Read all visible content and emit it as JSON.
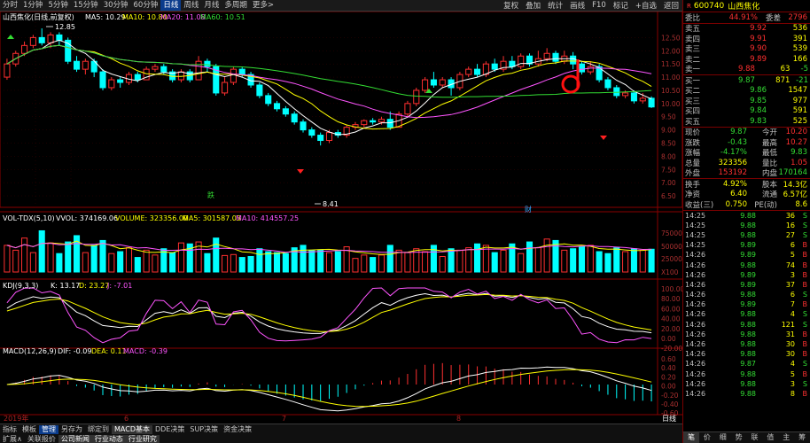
{
  "toolbar": {
    "tabs": [
      "分时",
      "1分钟",
      "5分钟",
      "15分钟",
      "30分钟",
      "60分钟",
      "日线",
      "周线",
      "月线",
      "多周期",
      "更多>"
    ],
    "active": "日线",
    "tools": [
      "复权",
      "叠加",
      "统计",
      "画线",
      "F10",
      "标记",
      "+自选",
      "返回"
    ]
  },
  "main_chart": {
    "title": "山西焦化(日线,前复权)",
    "ind": {
      "ma5": "MA5: 10.29",
      "ma10": "MA10: 10.80",
      "ma20": "MA20: 11.08",
      "ma60": "MA60: 10.51"
    },
    "high_label": "12.85",
    "low_label": "8.41",
    "ticks": [
      "12.50",
      "12.00",
      "11.50",
      "11.00",
      "10.50",
      "10.00",
      "9.50",
      "9.00",
      "8.50",
      "8.00",
      "7.50",
      "7.00",
      "6.50"
    ],
    "marker_die": "跌",
    "marker_cai": "财",
    "annotation": "d"
  },
  "vol_chart": {
    "title": "VOL-TDX(5,10)",
    "vvol": "VVOL: 374169.06",
    "volume": "VOLUME: 323356.00",
    "ma5": "MA5: 301587.03",
    "ma10": "MA10: 414557.25",
    "ticks": [
      "75000",
      "50000",
      "25000",
      "X100"
    ]
  },
  "kdj_chart": {
    "title": "KDJ(9,3,3)",
    "k": "K: 13.17",
    "d": "D: 23.27",
    "j": "J: -7.01",
    "ticks": [
      "100.00",
      "80.00",
      "60.00",
      "40.00",
      "20.00",
      "0.00",
      "-20.00"
    ]
  },
  "macd_chart": {
    "title": "MACD(12,26,9)",
    "dif": "DIF: -0.09",
    "dea": "DEA: 0.11",
    "macd": "MACD: -0.39",
    "ticks": [
      "0.60",
      "0.40",
      "0.20",
      "0.00",
      "-0.20",
      "-0.40",
      "-0.60"
    ]
  },
  "date_axis": {
    "year": "2019年",
    "labels": [
      "6",
      "7",
      "8"
    ],
    "period": "日线"
  },
  "bottom_tabs": {
    "row1": [
      "指标",
      "模板",
      "管理",
      "另存为",
      "绑定到",
      "MACD基本",
      "DDE决策",
      "SUP决策",
      "资金决策"
    ],
    "row1_sel": "管理",
    "row2": [
      "扩展∧",
      "关联报价",
      "公司新闻",
      "行业动态",
      "行业研究"
    ]
  },
  "quote": {
    "code": "600740",
    "name": "山西焦化",
    "badge": "R",
    "weibi": {
      "label": "委比",
      "value": "44.91%",
      "label2": "委差",
      "value2": "2796"
    },
    "sell": [
      {
        "label": "卖五",
        "price": "9.92",
        "vol": "536"
      },
      {
        "label": "卖四",
        "price": "9.91",
        "vol": "391"
      },
      {
        "label": "卖三",
        "price": "9.90",
        "vol": "539"
      },
      {
        "label": "卖二",
        "price": "9.89",
        "vol": "166"
      },
      {
        "label": "卖一",
        "price": "9.88",
        "vol": "63",
        "chg": "-5"
      }
    ],
    "buy": [
      {
        "label": "买一",
        "price": "9.87",
        "vol": "871",
        "chg": "-21"
      },
      {
        "label": "买二",
        "price": "9.86",
        "vol": "1547",
        "chg": ""
      },
      {
        "label": "买三",
        "price": "9.85",
        "vol": "977",
        "chg": ""
      },
      {
        "label": "买四",
        "price": "9.84",
        "vol": "591",
        "chg": ""
      },
      {
        "label": "买五",
        "price": "9.83",
        "vol": "525",
        "chg": ""
      }
    ],
    "stats": [
      {
        "l1": "现价",
        "v1": "9.87",
        "l2": "今开",
        "v2": "10.20"
      },
      {
        "l1": "涨跌",
        "v1": "-0.43",
        "l2": "最高",
        "v2": "10.27"
      },
      {
        "l1": "涨幅",
        "v1": "-4.17%",
        "l2": "最低",
        "v2": "9.83"
      },
      {
        "l1": "总量",
        "v1": "323356",
        "l2": "量比",
        "v2": "1.05"
      },
      {
        "l1": "外盘",
        "v1": "153192",
        "l2": "内盘",
        "v2": "170164"
      }
    ],
    "stats2": [
      {
        "l1": "换手",
        "v1": "4.92%",
        "l2": "股本",
        "v2": "14.3亿"
      },
      {
        "l1": "净资",
        "v1": "6.40",
        "l2": "流通",
        "v2": "6.57亿"
      },
      {
        "l1": "收益(三)",
        "v1": "0.750",
        "l2": "PE(动)",
        "v2": "8.6"
      }
    ],
    "ticks": [
      {
        "time": "14:25",
        "price": "9.88",
        "vol": "36",
        "dir": "S"
      },
      {
        "time": "14:25",
        "price": "9.88",
        "vol": "16",
        "dir": "S"
      },
      {
        "time": "14:25",
        "price": "9.88",
        "vol": "27",
        "dir": "S"
      },
      {
        "time": "14:25",
        "price": "9.89",
        "vol": "6",
        "dir": "B"
      },
      {
        "time": "14:26",
        "price": "9.89",
        "vol": "5",
        "dir": "B"
      },
      {
        "time": "14:26",
        "price": "9.88",
        "vol": "74",
        "dir": "B"
      },
      {
        "time": "14:26",
        "price": "9.89",
        "vol": "3",
        "dir": "B"
      },
      {
        "time": "14:26",
        "price": "9.89",
        "vol": "37",
        "dir": "B"
      },
      {
        "time": "14:26",
        "price": "9.88",
        "vol": "6",
        "dir": "S"
      },
      {
        "time": "14:26",
        "price": "9.89",
        "vol": "7",
        "dir": "B"
      },
      {
        "time": "14:26",
        "price": "9.88",
        "vol": "4",
        "dir": "S"
      },
      {
        "time": "14:26",
        "price": "9.88",
        "vol": "121",
        "dir": "S"
      },
      {
        "time": "14:26",
        "price": "9.88",
        "vol": "31",
        "dir": "B"
      },
      {
        "time": "14:26",
        "price": "9.88",
        "vol": "30",
        "dir": "B"
      },
      {
        "time": "14:26",
        "price": "9.88",
        "vol": "30",
        "dir": "B"
      },
      {
        "time": "14:26",
        "price": "9.87",
        "vol": "4",
        "dir": "S"
      },
      {
        "time": "14:26",
        "price": "9.88",
        "vol": "5",
        "dir": "B"
      },
      {
        "time": "14:26",
        "price": "9.88",
        "vol": "3",
        "dir": "S"
      },
      {
        "time": "14:26",
        "price": "9.88",
        "vol": "8",
        "dir": "B"
      }
    ],
    "footer": [
      "笔",
      "价",
      "细",
      "势",
      "联",
      "值",
      "主",
      "筹"
    ],
    "footer_sel": "笔"
  },
  "chart_data": {
    "type": "candlestick",
    "candles": [
      [
        11.0,
        11.5,
        11.7,
        10.9
      ],
      [
        11.5,
        11.9,
        12.0,
        11.4
      ],
      [
        11.9,
        12.2,
        12.35,
        11.8
      ],
      [
        12.2,
        12.5,
        12.6,
        12.1
      ],
      [
        12.5,
        12.3,
        12.85,
        12.2
      ],
      [
        12.3,
        12.6,
        12.7,
        12.1
      ],
      [
        12.6,
        12.4,
        12.7,
        12.2
      ],
      [
        12.4,
        11.6,
        12.5,
        11.5
      ],
      [
        11.6,
        11.3,
        11.8,
        11.2
      ],
      [
        11.3,
        11.6,
        11.7,
        11.1
      ],
      [
        11.6,
        11.2,
        11.7,
        11.0
      ],
      [
        11.2,
        10.6,
        11.3,
        10.5
      ],
      [
        10.6,
        10.9,
        11.0,
        10.5
      ],
      [
        10.9,
        10.8,
        11.0,
        10.6
      ],
      [
        10.8,
        11.1,
        11.2,
        10.7
      ],
      [
        11.1,
        10.9,
        11.2,
        10.8
      ],
      [
        10.9,
        11.3,
        11.4,
        10.9
      ],
      [
        11.3,
        11.4,
        11.5,
        11.2
      ],
      [
        11.4,
        11.2,
        11.5,
        11.1
      ],
      [
        11.2,
        10.9,
        11.3,
        10.8
      ],
      [
        10.9,
        11.2,
        11.3,
        10.8
      ],
      [
        11.2,
        10.9,
        11.3,
        10.8
      ],
      [
        10.9,
        11.6,
        11.8,
        10.9
      ],
      [
        11.6,
        11.4,
        11.7,
        11.2
      ],
      [
        11.4,
        10.4,
        11.5,
        10.3
      ],
      [
        10.4,
        10.8,
        11.0,
        10.3
      ],
      [
        10.8,
        11.3,
        11.4,
        10.7
      ],
      [
        11.3,
        11.1,
        11.4,
        11.0
      ],
      [
        11.1,
        10.7,
        11.2,
        10.6
      ],
      [
        10.7,
        10.3,
        10.8,
        10.2
      ],
      [
        10.3,
        10.0,
        10.4,
        9.9
      ],
      [
        10.0,
        9.8,
        10.1,
        9.7
      ],
      [
        9.8,
        9.6,
        9.9,
        9.5
      ],
      [
        9.6,
        9.3,
        9.7,
        9.2
      ],
      [
        9.3,
        9.0,
        9.4,
        8.9
      ],
      [
        9.0,
        8.8,
        9.1,
        8.7
      ],
      [
        8.8,
        8.6,
        8.9,
        8.41
      ],
      [
        8.6,
        8.9,
        9.0,
        8.5
      ],
      [
        8.9,
        8.8,
        9.0,
        8.7
      ],
      [
        8.8,
        9.1,
        9.2,
        8.7
      ],
      [
        9.1,
        9.2,
        9.3,
        9.0
      ],
      [
        9.2,
        9.35,
        9.4,
        9.1
      ],
      [
        9.35,
        9.3,
        9.45,
        9.2
      ],
      [
        9.3,
        9.4,
        9.5,
        9.2
      ],
      [
        9.4,
        9.1,
        9.7,
        9.0
      ],
      [
        9.1,
        9.6,
        9.7,
        9.1
      ],
      [
        9.6,
        10.0,
        10.1,
        9.5
      ],
      [
        10.0,
        10.5,
        10.6,
        9.9
      ],
      [
        10.5,
        10.9,
        11.0,
        10.4
      ],
      [
        10.9,
        10.7,
        11.2,
        10.6
      ],
      [
        10.7,
        10.9,
        11.0,
        10.6
      ],
      [
        10.9,
        10.6,
        11.0,
        10.3
      ],
      [
        10.6,
        11.1,
        11.2,
        10.5
      ],
      [
        11.1,
        11.3,
        11.4,
        11.0
      ],
      [
        11.3,
        11.1,
        11.5,
        11.0
      ],
      [
        11.1,
        11.5,
        11.6,
        11.0
      ],
      [
        11.5,
        11.3,
        11.7,
        11.2
      ],
      [
        11.3,
        11.6,
        11.8,
        11.2
      ],
      [
        11.6,
        11.4,
        11.8,
        11.3
      ],
      [
        11.4,
        11.8,
        11.9,
        11.3
      ],
      [
        11.8,
        11.5,
        11.9,
        11.4
      ],
      [
        11.5,
        11.7,
        12.0,
        11.4
      ],
      [
        11.7,
        11.9,
        12.1,
        11.6
      ],
      [
        11.9,
        11.6,
        12.0,
        11.5
      ],
      [
        11.6,
        11.8,
        12.0,
        11.5
      ],
      [
        11.8,
        11.5,
        11.95,
        11.3
      ],
      [
        11.5,
        11.2,
        11.6,
        11.1
      ],
      [
        11.2,
        11.4,
        11.6,
        11.1
      ],
      [
        11.4,
        10.9,
        11.5,
        10.8
      ],
      [
        10.9,
        10.6,
        11.0,
        10.5
      ],
      [
        10.6,
        10.3,
        10.7,
        10.2
      ],
      [
        10.3,
        10.4,
        10.5,
        10.2
      ],
      [
        10.4,
        10.1,
        10.5,
        10.0
      ],
      [
        10.1,
        10.2,
        10.4,
        10.0
      ],
      [
        10.2,
        9.87,
        10.27,
        9.83
      ]
    ],
    "ylim": [
      6.3,
      12.95
    ],
    "volumes": [
      55,
      45,
      70,
      40,
      85,
      60,
      38,
      62,
      75,
      40,
      55,
      65,
      38,
      42,
      50,
      30,
      45,
      35,
      48,
      40,
      60,
      58,
      62,
      38,
      70,
      34,
      36,
      30,
      32,
      48,
      42,
      40,
      38,
      50,
      55,
      44,
      45,
      40,
      42,
      52,
      28,
      35,
      30,
      35,
      55,
      45,
      40,
      48,
      42,
      55,
      32,
      48,
      45,
      50,
      58,
      55,
      40,
      45,
      58,
      38,
      62,
      50,
      68,
      65,
      45,
      48,
      52,
      55,
      42,
      38,
      50,
      42,
      48,
      45,
      47
    ],
    "vol_ylim": [
      0,
      95
    ],
    "macd_ylim": [
      -0.7,
      0.7
    ]
  }
}
